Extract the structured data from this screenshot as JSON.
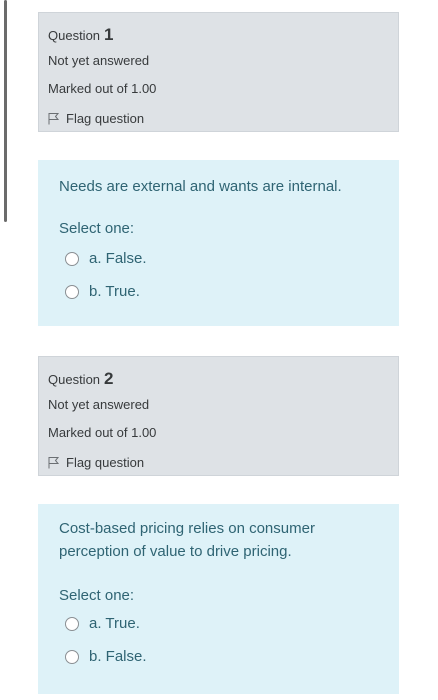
{
  "questions": [
    {
      "label": "Question",
      "number": "1",
      "status": "Not yet answered",
      "marks": "Marked out of 1.00",
      "flag": "Flag question",
      "text": "Needs are external and wants are internal.",
      "prompt": "Select one:",
      "options": [
        "a. False.",
        "b. True."
      ]
    },
    {
      "label": "Question",
      "number": "2",
      "status": "Not yet answered",
      "marks": "Marked out of 1.00",
      "flag": "Flag question",
      "text": "Cost-based pricing relies on consumer perception of value to drive pricing.",
      "prompt": "Select one:",
      "options": [
        "a. True.",
        "b. False."
      ]
    }
  ],
  "colors": {
    "info_bg": "#dee2e6",
    "content_bg": "#def2f8",
    "content_text": "#2f6473"
  },
  "icons": {
    "flag": "flag-icon",
    "radio": "radio-unchecked-icon"
  }
}
